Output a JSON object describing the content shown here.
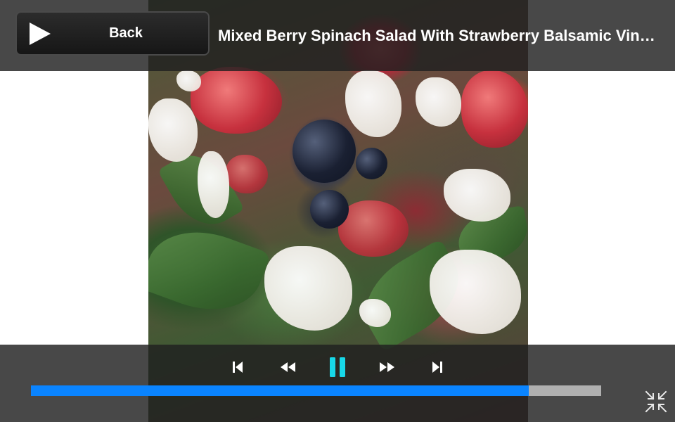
{
  "header": {
    "back_label": "Back",
    "title": "Mixed Berry Spinach Salad With Strawberry Balsamic Vin…"
  },
  "icons": {
    "back": "play-icon",
    "previous": "skip-previous-icon",
    "rewind": "rewind-icon",
    "pause": "pause-icon",
    "fast_forward": "fast-forward-icon",
    "next": "skip-next-icon",
    "exit_fullscreen": "exit-fullscreen-icon"
  },
  "playback": {
    "state": "playing",
    "progress_fraction": 0.873
  },
  "colors": {
    "progress_fill": "#0a84ff",
    "progress_track": "#b0b0b0",
    "pause_accent": "#17d8e8",
    "bar_background": "#202020"
  }
}
